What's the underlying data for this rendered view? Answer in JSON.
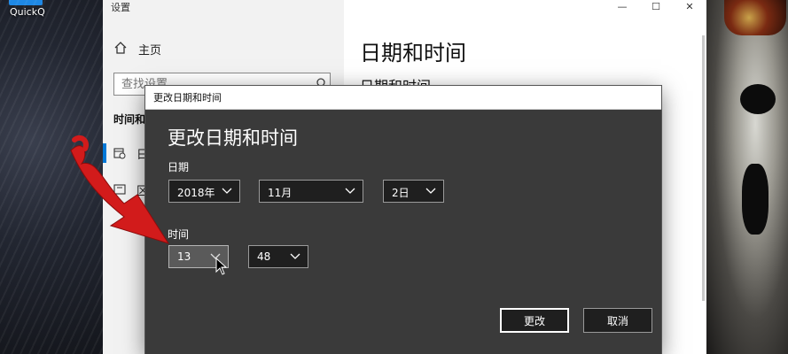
{
  "desktop": {
    "shortcut_label": "QuickQ"
  },
  "settings": {
    "window_title": "设置",
    "window_controls": [
      "—",
      "☐",
      "✕"
    ],
    "sidebar": {
      "home_label": "主页",
      "search_placeholder": "查找设置",
      "section_heading": "时间和",
      "items": [
        {
          "label": "日",
          "icon": "calendar-clock-icon"
        },
        {
          "label": "区",
          "icon": "region-icon"
        }
      ]
    },
    "main": {
      "title": "日期和时间",
      "subheading": "日期和时间"
    }
  },
  "dialog": {
    "title": "更改日期和时间",
    "heading": "更改日期和时间",
    "date_label": "日期",
    "year": "2018年",
    "month": "11月",
    "day": "2日",
    "time_label": "时间",
    "hour": "13",
    "minute": "48",
    "change_button": "更改",
    "cancel_button": "取消"
  },
  "colors": {
    "dialog_background": "#3a3a3a",
    "arrow": "#d21b1b",
    "accent": "#0078d7"
  }
}
